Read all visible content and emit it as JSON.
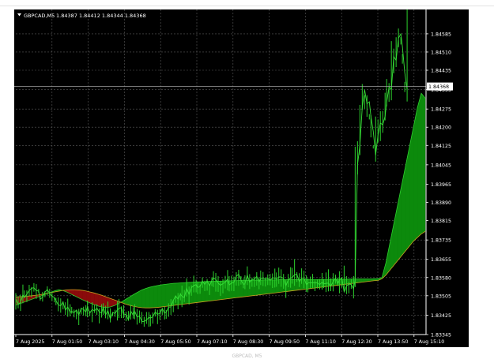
{
  "window": {
    "symbol_label": "GBPCAD,M5",
    "ohlc_label": "1.84387 1.84412 1.84344 1.84368",
    "menu_icon": "triangle-down-icon"
  },
  "caption": "GBPCAD, M5",
  "colors": {
    "background": "#000000",
    "foreground": "#ffffff",
    "grid": "#5a5a5a",
    "bull_cloud": "#0c8a0c",
    "bear_cloud": "#8a0b0b",
    "line_upper": "#2ecc2e",
    "line_lower": "#c8a020",
    "price_line": "#a0a0a0"
  },
  "chart_data": {
    "type": "line",
    "title": "GBPCAD,M5",
    "ohlc": {
      "open": 1.84387,
      "high": 1.84412,
      "low": 1.84344,
      "close": 1.84368
    },
    "current_price": 1.84368,
    "current_price_label": "1.84368",
    "ylim": [
      1.83345,
      1.8464
    ],
    "y_ticks": [
      "1.84585",
      "1.84510",
      "1.84435",
      "1.84355",
      "1.84275",
      "1.84200",
      "1.84125",
      "1.84045",
      "1.83965",
      "1.83890",
      "1.83815",
      "1.83735",
      "1.83655",
      "1.83580",
      "1.83505",
      "1.83425",
      "1.83345"
    ],
    "x_ticks": [
      "7 Aug 2025",
      "7 Aug 01:50",
      "7 Aug 03:10",
      "7 Aug 04:30",
      "7 Aug 05:50",
      "7 Aug 07:10",
      "7 Aug 08:30",
      "7 Aug 09:50",
      "7 Aug 11:10",
      "7 Aug 12:30",
      "7 Aug 13:50",
      "7 Aug 15:10"
    ],
    "grid": true,
    "price_series": {
      "name": "",
      "x": [
        0,
        3,
        6,
        9,
        11,
        14,
        17,
        20,
        23,
        26,
        29,
        31,
        34,
        37,
        40,
        43,
        46,
        49,
        51,
        54,
        57,
        60,
        63,
        66,
        69,
        71,
        74,
        77,
        80,
        83,
        86,
        89,
        91,
        94,
        97,
        100,
        103,
        106,
        109,
        111,
        114,
        117,
        120,
        123,
        126,
        129,
        131,
        134,
        137,
        140,
        143,
        146,
        149,
        151,
        154,
        157,
        160,
        163,
        166,
        169,
        171,
        174,
        177,
        180,
        183,
        186,
        189,
        191,
        194,
        197,
        200,
        203,
        206,
        209,
        211,
        214,
        217,
        220,
        223,
        226,
        229,
        231,
        234,
        237,
        240,
        243,
        246,
        249,
        251,
        254,
        257,
        260,
        263,
        266,
        269,
        271,
        274,
        277,
        280,
        283,
        286,
        289,
        291,
        294,
        297,
        300,
        303,
        306,
        309,
        311,
        314,
        317,
        320,
        323,
        326,
        329,
        331,
        334,
        337,
        340,
        343,
        346,
        349,
        351,
        354,
        357,
        360,
        363,
        366,
        369,
        371,
        374,
        377,
        380,
        383,
        386,
        389,
        391,
        394,
        397,
        400,
        403,
        406,
        409,
        411,
        414,
        417,
        420,
        423,
        426,
        429,
        431,
        434,
        437,
        440,
        443,
        446,
        449,
        451,
        454,
        457,
        460,
        463,
        466,
        469,
        471,
        474,
        477,
        480,
        483,
        486,
        489,
        491,
        494,
        497,
        500,
        503,
        506,
        509,
        511,
        514,
        517,
        520
      ],
      "values": [
        1.83492,
        1.83469,
        1.83478,
        1.83509,
        1.83498,
        1.83512,
        1.83526,
        1.83536,
        1.83538,
        1.83526,
        1.83524,
        1.83491,
        1.83498,
        1.8352,
        1.83531,
        1.83514,
        1.83503,
        1.83498,
        1.83485,
        1.83467,
        1.83464,
        1.83479,
        1.83446,
        1.83459,
        1.83437,
        1.8344,
        1.83436,
        1.83446,
        1.83426,
        1.83452,
        1.83449,
        1.83438,
        1.83459,
        1.83434,
        1.83448,
        1.83443,
        1.83454,
        1.83438,
        1.83434,
        1.83459,
        1.83426,
        1.83444,
        1.8341,
        1.83436,
        1.83432,
        1.83447,
        1.83453,
        1.83456,
        1.83427,
        1.83428,
        1.83405,
        1.83442,
        1.83425,
        1.83442,
        1.83417,
        1.83422,
        1.83399,
        1.83399,
        1.83405,
        1.83416,
        1.83413,
        1.83418,
        1.83438,
        1.83428,
        1.83433,
        1.83452,
        1.83433,
        1.83437,
        1.83458,
        1.83459,
        1.83486,
        1.83504,
        1.83491,
        1.83511,
        1.83503,
        1.83497,
        1.83536,
        1.8351,
        1.83538,
        1.83547,
        1.83551,
        1.83539,
        1.83543,
        1.83566,
        1.83551,
        1.83567,
        1.83546,
        1.83569,
        1.83579,
        1.83572,
        1.83557,
        1.83548,
        1.83555,
        1.8356,
        1.83574,
        1.83549,
        1.83558,
        1.8356,
        1.83585,
        1.83594,
        1.8357,
        1.83552,
        1.83554,
        1.8359,
        1.8356,
        1.83572,
        1.83573,
        1.83585,
        1.83561,
        1.83577,
        1.83578,
        1.83573,
        1.83577,
        1.83568,
        1.83579,
        1.83578,
        1.83573,
        1.83583,
        1.83582,
        1.83576,
        1.83546,
        1.8357,
        1.83579,
        1.83579,
        1.83592,
        1.83593,
        1.83563,
        1.83577,
        1.83579,
        1.83551,
        1.83558,
        1.83558,
        1.83559,
        1.83558,
        1.83558,
        1.83551,
        1.83561,
        1.83554,
        1.83556,
        1.83557,
        1.83545,
        1.83562,
        1.83578,
        1.83554,
        1.8357,
        1.83579,
        1.83521,
        1.83545,
        1.83553,
        1.83551,
        1.83534,
        1.83572,
        1.84045,
        1.84125,
        1.84281,
        1.84355,
        1.84297,
        1.84305,
        1.84245,
        1.84183,
        1.84085,
        1.84167,
        1.84217,
        1.8421,
        1.84245,
        1.84302,
        1.84366,
        1.84356,
        1.84491,
        1.84476,
        1.84567,
        1.84585,
        1.84533,
        1.84425,
        1.84355
      ],
      "highs": [
        1.83516,
        1.83503,
        1.8351,
        1.83551,
        1.83527,
        1.83527,
        1.8355,
        1.83541,
        1.83557,
        1.83553,
        1.83533,
        1.83504,
        1.83521,
        1.83524,
        1.83544,
        1.83534,
        1.8352,
        1.83499,
        1.83496,
        1.83498,
        1.83494,
        1.83482,
        1.83478,
        1.83493,
        1.8347,
        1.83459,
        1.83448,
        1.83447,
        1.83451,
        1.83456,
        1.8346,
        1.83466,
        1.83485,
        1.83441,
        1.83478,
        1.83468,
        1.8347,
        1.83453,
        1.8347,
        1.83474,
        1.83464,
        1.83481,
        1.83453,
        1.83438,
        1.83447,
        1.83481,
        1.83492,
        1.83461,
        1.83466,
        1.83439,
        1.83442,
        1.83468,
        1.83458,
        1.8347,
        1.8345,
        1.83444,
        1.83438,
        1.83418,
        1.83438,
        1.83438,
        1.83427,
        1.83436,
        1.8345,
        1.83447,
        1.8345,
        1.83455,
        1.83459,
        1.83446,
        1.83474,
        1.83491,
        1.83488,
        1.83506,
        1.83516,
        1.83517,
        1.83547,
        1.83529,
        1.83577,
        1.83543,
        1.83548,
        1.83588,
        1.83571,
        1.8356,
        1.83551,
        1.83581,
        1.83567,
        1.83574,
        1.83552,
        1.83581,
        1.83606,
        1.83599,
        1.83586,
        1.83567,
        1.83574,
        1.83587,
        1.83611,
        1.83586,
        1.83588,
        1.83584,
        1.83602,
        1.83612,
        1.83586,
        1.83577,
        1.83589,
        1.83626,
        1.83594,
        1.8358,
        1.83584,
        1.83602,
        1.83582,
        1.83609,
        1.83603,
        1.83581,
        1.83593,
        1.83595,
        1.83597,
        1.83617,
        1.83601,
        1.83621,
        1.83614,
        1.83595,
        1.8357,
        1.83595,
        1.83623,
        1.8362,
        1.83656,
        1.83602,
        1.83598,
        1.83618,
        1.83608,
        1.83589,
        1.83577,
        1.83584,
        1.83595,
        1.83568,
        1.83572,
        1.83574,
        1.83599,
        1.83574,
        1.83601,
        1.83614,
        1.83576,
        1.83598,
        1.83592,
        1.8358,
        1.83606,
        1.83582,
        1.83629,
        1.83586,
        1.83563,
        1.83574,
        1.83586,
        1.8412,
        1.84142,
        1.84292,
        1.84378,
        1.84332,
        1.84332,
        1.84254,
        1.84249,
        1.84125,
        1.84244,
        1.84232,
        1.84266,
        1.84267,
        1.84342,
        1.84399,
        1.84382,
        1.84555,
        1.84524,
        1.84571,
        1.84607,
        1.84572,
        1.84502,
        1.84387
      ],
      "lows": [
        1.83448,
        1.83453,
        1.83442,
        1.83474,
        1.83495,
        1.83479,
        1.83504,
        1.83499,
        1.83522,
        1.83492,
        1.83516,
        1.83485,
        1.83481,
        1.83499,
        1.83507,
        1.83496,
        1.83484,
        1.83478,
        1.83466,
        1.83441,
        1.83435,
        1.83449,
        1.83426,
        1.83418,
        1.8342,
        1.83431,
        1.83416,
        1.83408,
        1.83384,
        1.83428,
        1.83423,
        1.8342,
        1.83416,
        1.83421,
        1.83396,
        1.83434,
        1.83426,
        1.83391,
        1.83415,
        1.83426,
        1.83412,
        1.83408,
        1.83395,
        1.83421,
        1.83418,
        1.83403,
        1.83413,
        1.83413,
        1.83413,
        1.834,
        1.83402,
        1.83407,
        1.83411,
        1.83408,
        1.83386,
        1.83393,
        1.83389,
        1.83377,
        1.83389,
        1.83377,
        1.83379,
        1.8339,
        1.83419,
        1.83388,
        1.83406,
        1.83426,
        1.83407,
        1.8341,
        1.83418,
        1.83426,
        1.83437,
        1.83476,
        1.83449,
        1.83486,
        1.83458,
        1.83479,
        1.83502,
        1.83468,
        1.83505,
        1.83519,
        1.83519,
        1.83512,
        1.83513,
        1.83538,
        1.83524,
        1.83526,
        1.83508,
        1.83545,
        1.83541,
        1.83522,
        1.83521,
        1.83504,
        1.83515,
        1.83535,
        1.83527,
        1.83523,
        1.83525,
        1.83524,
        1.83547,
        1.83546,
        1.83551,
        1.83536,
        1.83532,
        1.83549,
        1.83533,
        1.83542,
        1.83541,
        1.83547,
        1.83532,
        1.83549,
        1.83545,
        1.83543,
        1.83549,
        1.83548,
        1.83537,
        1.83539,
        1.83542,
        1.83554,
        1.83542,
        1.83534,
        1.83496,
        1.8354,
        1.83538,
        1.83555,
        1.83546,
        1.83562,
        1.83541,
        1.83554,
        1.83536,
        1.83521,
        1.83519,
        1.83535,
        1.83536,
        1.83524,
        1.83535,
        1.83531,
        1.8353,
        1.83537,
        1.8352,
        1.83523,
        1.83524,
        1.83523,
        1.83555,
        1.83545,
        1.83515,
        1.83538,
        1.83524,
        1.83512,
        1.83515,
        1.83533,
        1.83494,
        1.83541,
        1.84005,
        1.84085,
        1.84272,
        1.84276,
        1.84243,
        1.84232,
        1.84158,
        1.84112,
        1.84058,
        1.84137,
        1.84143,
        1.84177,
        1.84228,
        1.84286,
        1.84305,
        1.84311,
        1.84422,
        1.84448,
        1.8453,
        1.84541,
        1.84462,
        1.84345,
        1.84306
      ]
    },
    "cloud_series": [
      {
        "name": "",
        "x": [
          0,
          5,
          10,
          15,
          20,
          25,
          30,
          35,
          40,
          45,
          50,
          55,
          60,
          65,
          70,
          75,
          80,
          85,
          90,
          95,
          100,
          105,
          110,
          115,
          120,
          125,
          130,
          135,
          140,
          145,
          150,
          155,
          160,
          165,
          170,
          175,
          180,
          185,
          190,
          195,
          200,
          205,
          210,
          215,
          220,
          225,
          230,
          235,
          240,
          245,
          250,
          255,
          260,
          265,
          270,
          275,
          280,
          285,
          290,
          295,
          300,
          305,
          310,
          315,
          320,
          325,
          330,
          335,
          340,
          345,
          350,
          355,
          360,
          365,
          370,
          375,
          380,
          385,
          390,
          395,
          400,
          405,
          410,
          415,
          420,
          425,
          430,
          435,
          440,
          445,
          450,
          455,
          460,
          465,
          470,
          475,
          480,
          485,
          490,
          495,
          500,
          505,
          510,
          515,
          520
        ],
        "values": [
          1.83466,
          1.83472,
          1.83478,
          1.83484,
          1.8349,
          1.83496,
          1.83502,
          1.83508,
          1.83514,
          1.8352,
          1.83526,
          1.8353,
          1.83526,
          1.8352,
          1.83512,
          1.83504,
          1.83496,
          1.83488,
          1.83481,
          1.83474,
          1.83468,
          1.83462,
          1.83458,
          1.83456,
          1.83459,
          1.83464,
          1.83472,
          1.83481,
          1.83491,
          1.83501,
          1.83511,
          1.8352,
          1.83529,
          1.83535,
          1.8354,
          1.83544,
          1.83547,
          1.8355,
          1.83552,
          1.83554,
          1.83556,
          1.83557,
          1.83558,
          1.83559,
          1.8356,
          1.83561,
          1.83562,
          1.83562,
          1.83563,
          1.83564,
          1.83564,
          1.83565,
          1.83565,
          1.83566,
          1.83566,
          1.83567,
          1.83567,
          1.83568,
          1.83568,
          1.83568,
          1.83569,
          1.83569,
          1.83569,
          1.8357,
          1.8357,
          1.8357,
          1.8357,
          1.83571,
          1.83571,
          1.83571,
          1.83571,
          1.83571,
          1.83572,
          1.83572,
          1.83572,
          1.83572,
          1.83572,
          1.83572,
          1.83572,
          1.83572,
          1.83573,
          1.83573,
          1.83573,
          1.83573,
          1.83573,
          1.83574,
          1.83574,
          1.83574,
          1.83574,
          1.83574,
          1.83574,
          1.83575,
          1.83575,
          1.8358,
          1.8364,
          1.8372,
          1.838,
          1.8388,
          1.8396,
          1.8404,
          1.8412,
          1.842,
          1.8428,
          1.8434,
          1.8432
        ]
      },
      {
        "name": "",
        "x": [
          0,
          5,
          10,
          15,
          20,
          25,
          30,
          35,
          40,
          45,
          50,
          55,
          60,
          65,
          70,
          75,
          80,
          85,
          90,
          95,
          100,
          105,
          110,
          115,
          120,
          125,
          130,
          135,
          140,
          145,
          150,
          155,
          160,
          165,
          170,
          175,
          180,
          185,
          190,
          195,
          200,
          205,
          210,
          215,
          220,
          225,
          230,
          235,
          240,
          245,
          250,
          255,
          260,
          265,
          270,
          275,
          280,
          285,
          290,
          295,
          300,
          305,
          310,
          315,
          320,
          325,
          330,
          335,
          340,
          345,
          350,
          355,
          360,
          365,
          370,
          375,
          380,
          385,
          390,
          395,
          400,
          405,
          410,
          415,
          420,
          425,
          430,
          435,
          440,
          445,
          450,
          455,
          460,
          465,
          470,
          475,
          480,
          485,
          490,
          495,
          500,
          505,
          510,
          515,
          520
        ],
        "values": [
          1.835,
          1.83501,
          1.83502,
          1.83503,
          1.83505,
          1.83507,
          1.83509,
          1.83512,
          1.83515,
          1.83518,
          1.83521,
          1.83524,
          1.83527,
          1.83529,
          1.8353,
          1.8353,
          1.83529,
          1.83527,
          1.83524,
          1.8352,
          1.83516,
          1.83511,
          1.83506,
          1.835,
          1.83494,
          1.83488,
          1.83482,
          1.83476,
          1.8347,
          1.83465,
          1.83461,
          1.83458,
          1.83456,
          1.83455,
          1.83455,
          1.83456,
          1.83457,
          1.83459,
          1.83461,
          1.83463,
          1.83465,
          1.83467,
          1.83469,
          1.83471,
          1.83473,
          1.83475,
          1.83477,
          1.83479,
          1.83481,
          1.83483,
          1.83485,
          1.83487,
          1.83489,
          1.83491,
          1.83493,
          1.83495,
          1.83497,
          1.83499,
          1.83501,
          1.83503,
          1.83505,
          1.83507,
          1.83509,
          1.83511,
          1.83513,
          1.83515,
          1.83517,
          1.83519,
          1.83521,
          1.83523,
          1.83525,
          1.83527,
          1.83529,
          1.83531,
          1.83533,
          1.83535,
          1.83537,
          1.83539,
          1.83541,
          1.83543,
          1.83545,
          1.83547,
          1.83549,
          1.83551,
          1.83553,
          1.83555,
          1.83557,
          1.83559,
          1.83561,
          1.83563,
          1.83565,
          1.83567,
          1.83568,
          1.83575,
          1.8359,
          1.8361,
          1.8363,
          1.8365,
          1.8367,
          1.8369,
          1.8371,
          1.8373,
          1.83745,
          1.8376,
          1.8377
        ]
      }
    ]
  }
}
